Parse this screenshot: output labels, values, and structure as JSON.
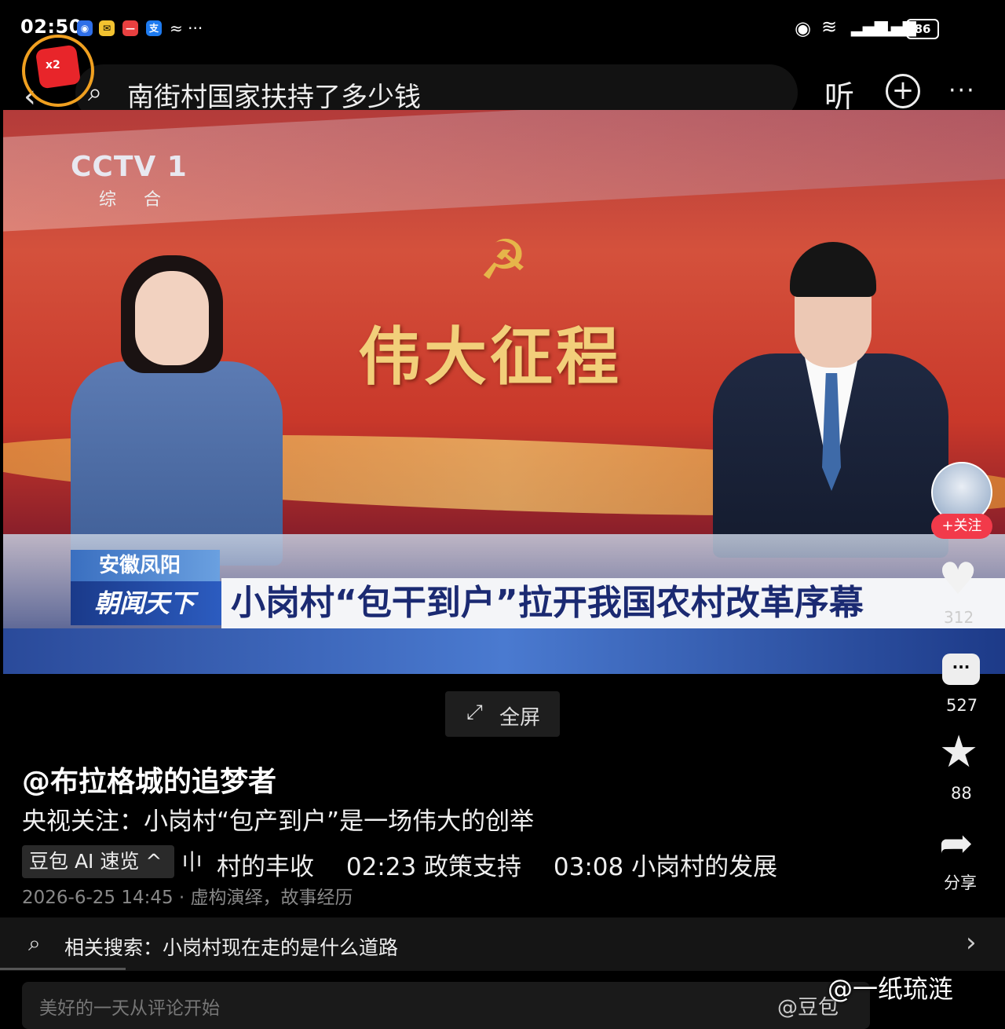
{
  "status_bar": {
    "time": "02:50",
    "battery": "86"
  },
  "top_bar": {
    "search_query": "南街村国家扶持了多少钱",
    "listen_label": "听",
    "reward_badge": "x2"
  },
  "video": {
    "channel_logo": "CCTV 1",
    "channel_sub": "综 合",
    "backdrop_title": "伟大征程",
    "location_tag": "安徽凤阳",
    "program_name": "朝闻天下",
    "headline": "小岗村“包干到户”拉开我国农村改革序幕"
  },
  "fullscreen_label": "全屏",
  "actions": {
    "follow_label": "+关注",
    "likes": "312",
    "comments": "527",
    "favorites": "88",
    "share_label": "分享"
  },
  "post": {
    "author": "@布拉格城的追梦者",
    "caption": "央视关注：小岗村“包产到户”是一场伟大的创举",
    "ai_label": "豆包 AI 速览 ^",
    "chapters": "村的丰收　 02:23 政策支持　 03:08 小岗村的发展",
    "meta": "2026-6-25 14:45 · 虚构演绎，故事经历"
  },
  "related_search": {
    "label": "相关搜索：小岗村现在走的是什么道路"
  },
  "comment_input": {
    "placeholder": "美好的一天从评论开始"
  },
  "watermark": {
    "text": "@一纸琉涟",
    "overlay": "@豆包"
  },
  "colors": {
    "accent_red": "#f23a4a",
    "headline_blue": "#1b2a72"
  }
}
